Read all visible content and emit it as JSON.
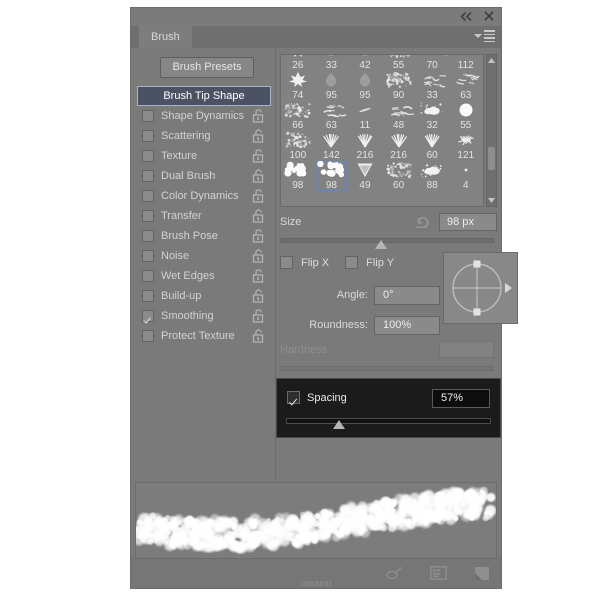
{
  "panel": {
    "tab_label": "Brush",
    "collapse_icon": "double-left-arrow-icon",
    "close_icon": "close-icon",
    "menu_icon": "panel-menu-icon"
  },
  "left": {
    "presets_button": "Brush Presets",
    "options": [
      {
        "label": "Brush Tip Shape",
        "checked": false,
        "selected": true,
        "lock": false
      },
      {
        "label": "Shape Dynamics",
        "checked": false,
        "selected": false,
        "lock": true
      },
      {
        "label": "Scattering",
        "checked": false,
        "selected": false,
        "lock": true
      },
      {
        "label": "Texture",
        "checked": false,
        "selected": false,
        "lock": true
      },
      {
        "label": "Dual Brush",
        "checked": false,
        "selected": false,
        "lock": true
      },
      {
        "label": "Color Dynamics",
        "checked": false,
        "selected": false,
        "lock": true
      },
      {
        "label": "Transfer",
        "checked": false,
        "selected": false,
        "lock": true
      },
      {
        "label": "Brush Pose",
        "checked": false,
        "selected": false,
        "lock": true
      },
      {
        "label": "Noise",
        "checked": false,
        "selected": false,
        "lock": true
      },
      {
        "label": "Wet Edges",
        "checked": false,
        "selected": false,
        "lock": true
      },
      {
        "label": "Build-up",
        "checked": false,
        "selected": false,
        "lock": true
      },
      {
        "label": "Smoothing",
        "checked": true,
        "selected": false,
        "lock": true
      },
      {
        "label": "Protect Texture",
        "checked": false,
        "selected": false,
        "lock": true
      }
    ]
  },
  "brush_grid": {
    "selected_index": 25,
    "cells": [
      {
        "size": "26",
        "shape": "maple-leaf"
      },
      {
        "size": "33",
        "shape": "blob"
      },
      {
        "size": "42",
        "shape": "blob"
      },
      {
        "size": "55",
        "shape": "speckle"
      },
      {
        "size": "70",
        "shape": "scribble"
      },
      {
        "size": "112",
        "shape": "slash"
      },
      {
        "size": "74",
        "shape": "maple-leaf"
      },
      {
        "size": "95",
        "shape": "teardrop"
      },
      {
        "size": "95",
        "shape": "teardrop"
      },
      {
        "size": "90",
        "shape": "speckle"
      },
      {
        "size": "33",
        "shape": "scribble"
      },
      {
        "size": "63",
        "shape": "scribble"
      },
      {
        "size": "66",
        "shape": "speckle"
      },
      {
        "size": "63",
        "shape": "scribble"
      },
      {
        "size": "11",
        "shape": "slash"
      },
      {
        "size": "48",
        "shape": "scribble"
      },
      {
        "size": "32",
        "shape": "splatter"
      },
      {
        "size": "55",
        "shape": "circle"
      },
      {
        "size": "100",
        "shape": "speckle"
      },
      {
        "size": "142",
        "shape": "grass"
      },
      {
        "size": "216",
        "shape": "grass"
      },
      {
        "size": "216",
        "shape": "grass"
      },
      {
        "size": "60",
        "shape": "grass"
      },
      {
        "size": "121",
        "shape": "starburst"
      },
      {
        "size": "98",
        "shape": "cloud-cluster"
      },
      {
        "size": "98",
        "shape": "cloud-cluster"
      },
      {
        "size": "49",
        "shape": "cone"
      },
      {
        "size": "60",
        "shape": "speckle"
      },
      {
        "size": "88",
        "shape": "splatter"
      },
      {
        "size": "4",
        "shape": "dot"
      }
    ]
  },
  "controls": {
    "size_label": "Size",
    "size_value": "98 px",
    "size_slider_percent": 47,
    "reset_icon": "reset-arrow-icon",
    "flip_x_label": "Flip X",
    "flip_y_label": "Flip Y",
    "flip_x_checked": false,
    "flip_y_checked": false,
    "angle_label": "Angle:",
    "angle_value": "0°",
    "roundness_label": "Roundness:",
    "roundness_value": "100%",
    "hardness_label": "Hardness",
    "hardness_value": "",
    "spacing_label": "Spacing",
    "spacing_value": "57%",
    "spacing_checked": true,
    "spacing_slider_percent": 26
  },
  "footer": {
    "icons": [
      {
        "name": "toggle-brush-settings-icon"
      },
      {
        "name": "brush-presets-panel-icon"
      },
      {
        "name": "new-brush-preset-icon"
      }
    ]
  },
  "colors": {
    "panel_bg": "#7a7a7a",
    "selected_item": "#4a5264",
    "highlight_block": "#1b1b1b",
    "selection_outline": "#6e86ae",
    "text": "#d3d3d3"
  }
}
